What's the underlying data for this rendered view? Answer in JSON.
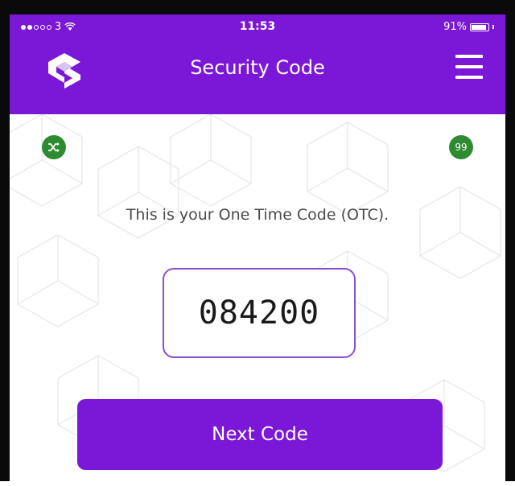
{
  "status_bar": {
    "carrier": "3",
    "time": "11:53",
    "battery": "91%",
    "battery_level": 0.91,
    "wifi_icon": "wifi-icon"
  },
  "header": {
    "title": "Security Code",
    "logo_icon": "app-logo-icon",
    "menu_icon": "hamburger-menu-icon"
  },
  "main": {
    "shuffle_icon": "shuffle-icon",
    "badge_count": "99",
    "info_text": "This is your One Time Code (OTC).",
    "otc_code": "084200",
    "next_button_label": "Next Code"
  },
  "colors": {
    "brand_purple": "#7b17d6",
    "badge_green": "#2e8b32",
    "code_border": "#8b4dcf"
  }
}
